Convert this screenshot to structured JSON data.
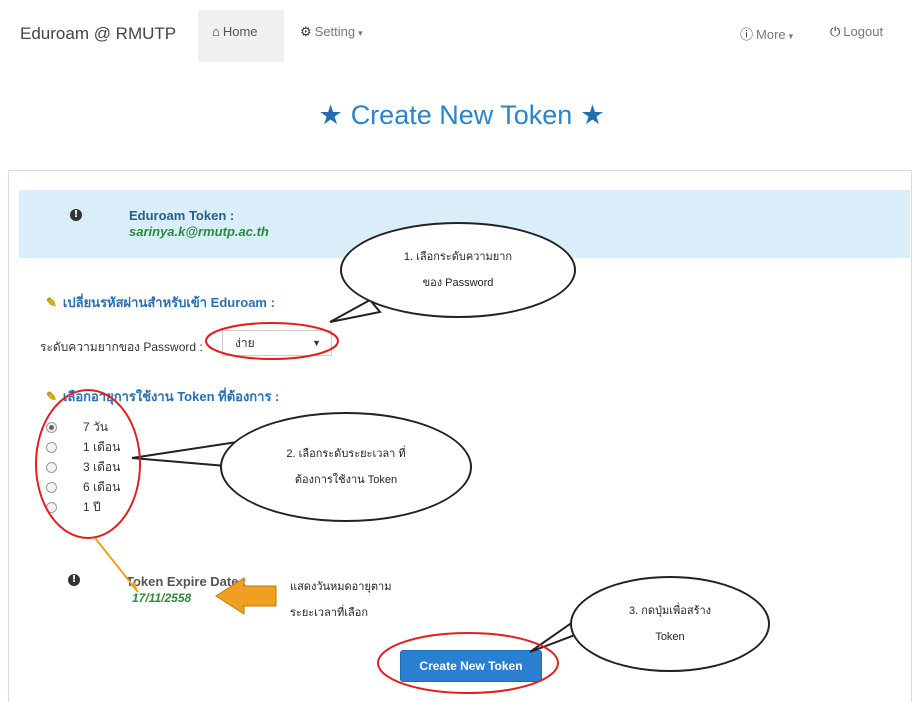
{
  "nav": {
    "brand": "Eduroam @ RMUTP",
    "home": "Home",
    "setting": "Setting",
    "more": "More",
    "logout": "Logout"
  },
  "page_title": "Create New Token",
  "token_info": {
    "title": "Eduroam Token :",
    "email": "sarinya.k@rmutp.ac.th"
  },
  "password_section": {
    "heading": "เปลี่ยนรหัสผ่านสำหรับเข้า Eduroam :",
    "label": "ระดับความยากของ Password :",
    "selected": "ง่าย"
  },
  "duration_section": {
    "heading": "เลือกอายุการใช้งาน Token ที่ต้องการ :",
    "options": [
      "7 วัน",
      "1 เดือน",
      "3 เดือน",
      "6 เดือน",
      "1 ปี"
    ]
  },
  "expire": {
    "title": "Token Expire Date :",
    "date": "17/11/2558",
    "note_line1": "แสดงวันหมดอายุตาม",
    "note_line2": "ระยะเวลาที่เลือก"
  },
  "create_button": "Create New Token",
  "callouts": {
    "c1_line1": "1. เลือกระดับความยาก",
    "c1_line2": "ของ Password",
    "c2_line1": "2. เลือกระดับระยะเวลา ที่",
    "c2_line2": "ต้องการใช้งาน Token",
    "c3_line1": "3. กดปุ่มเพื่อสร้าง",
    "c3_line2": "Token"
  },
  "colors": {
    "accent": "#2a84c9",
    "alert_bg": "#d9eef8",
    "button": "#2a7fd0",
    "highlight_red": "#e02020",
    "arrow_orange": "#f0a020"
  }
}
